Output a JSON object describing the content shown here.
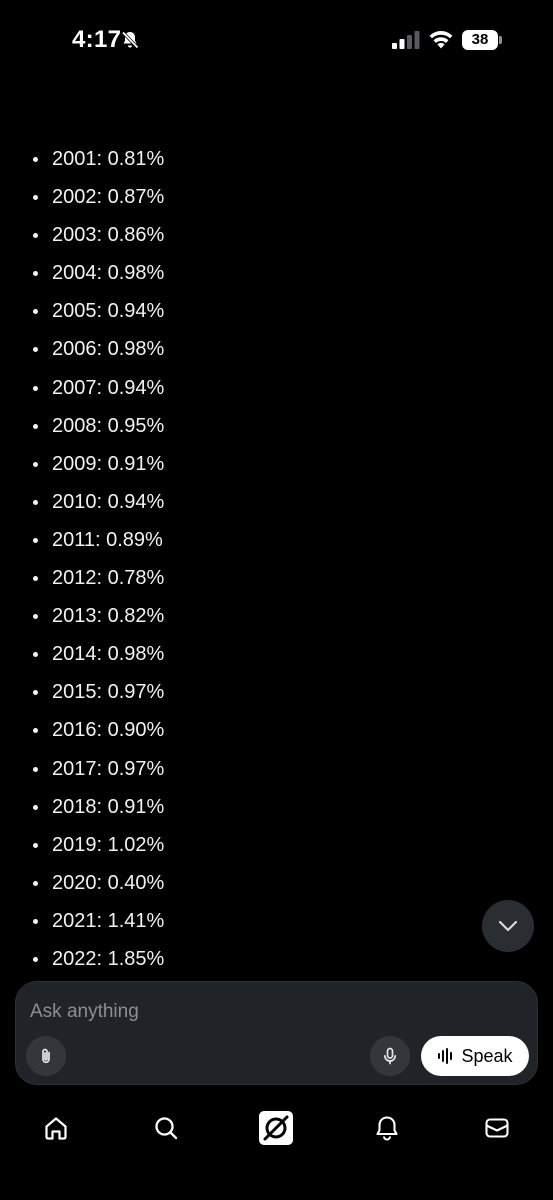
{
  "status_bar": {
    "time": "4:17",
    "battery": "38",
    "icons": [
      "bell-slash-icon",
      "signal-icon",
      "wifi-icon",
      "battery-icon"
    ]
  },
  "list": {
    "items": [
      "2001: 0.81%",
      "2002: 0.87%",
      "2003: 0.86%",
      "2004: 0.98%",
      "2005: 0.94%",
      "2006: 0.98%",
      "2007: 0.94%",
      "2008: 0.95%",
      "2009: 0.91%",
      "2010: 0.94%",
      "2011: 0.89%",
      "2012: 0.78%",
      "2013: 0.82%",
      "2014: 0.98%",
      "2015: 0.97%",
      "2016: 0.90%",
      "2017: 0.97%",
      "2018: 0.91%",
      "2019: 1.02%",
      "2020: 0.40%",
      "2021: 1.41%",
      "2022: 1.85%"
    ]
  },
  "composer": {
    "placeholder": "Ask anything",
    "speak_label": "Speak"
  },
  "nav": {
    "items": [
      "home-icon",
      "search-icon",
      "grok-icon",
      "bell-icon",
      "mail-icon"
    ]
  }
}
